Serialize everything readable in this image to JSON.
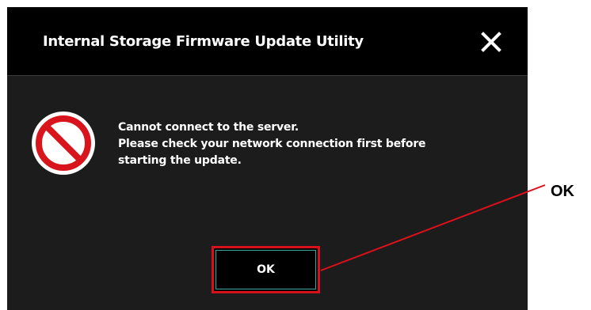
{
  "dialog": {
    "title": "Internal Storage Firmware Update Utility",
    "close_icon": "close-icon",
    "error_icon": "prohibited-icon",
    "message_lines": [
      "Cannot connect to the server.",
      "Please check your network connection first before",
      "starting the update."
    ],
    "ok_label": "OK"
  },
  "annotation": {
    "label": "OK",
    "color": "#e0101a"
  },
  "colors": {
    "titlebar": "#000000",
    "body": "#1c1c1c",
    "text": "#ffffff",
    "button_highlight": "#d8101c"
  }
}
